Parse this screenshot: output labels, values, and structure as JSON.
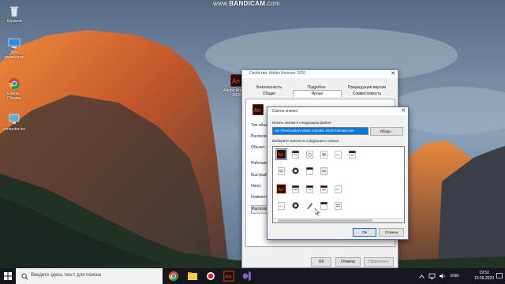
{
  "watermark": {
    "brand": "BANDICAM",
    "suffix": ".com",
    "prefix": "www."
  },
  "desktop_icons": [
    {
      "label": "Корзина"
    },
    {
      "label": "Этот компьютер"
    },
    {
      "label": "Елена - Chrome"
    },
    {
      "label": "computer.ico"
    },
    {
      "label": "Adobe Animate 2020"
    }
  ],
  "properties_window": {
    "title": "Свойства: Adobe Animate 2020",
    "tabs_row1": [
      "Безопасность",
      "Подробно",
      "Предыдущие версии"
    ],
    "tabs_row2": [
      "Общие",
      "Ярлык",
      "Совместимость"
    ],
    "field_labels": [
      "Тип объекта:",
      "Располож.",
      "Объект:",
      "Рабочая папка:",
      "Быстрый вызов:",
      "Окно:",
      "Комментарий:"
    ],
    "open_location_button": "Располож...",
    "ok": "ОК",
    "cancel": "Отмена",
    "apply": "Применить"
  },
  "change_icon_dialog": {
    "title": "Смена значка",
    "path_label": "Искать значки в следующем файле:",
    "path_value": "am Files\\Adobe\\Adobe Animate 2020\\Animate.exe",
    "browse": "Обзор...",
    "list_label": "Выберите значок из следующего списка:",
    "ok": "ОК",
    "cancel": "Отмена"
  },
  "taskbar": {
    "search_placeholder": "Введите здесь текст для поиска",
    "language": "ENG",
    "time": "19:52",
    "date": "13.06.2020"
  },
  "colors": {
    "accent": "#0078d7",
    "animate_brand": "#e6683a",
    "animate_bg": "#2c0a01"
  }
}
